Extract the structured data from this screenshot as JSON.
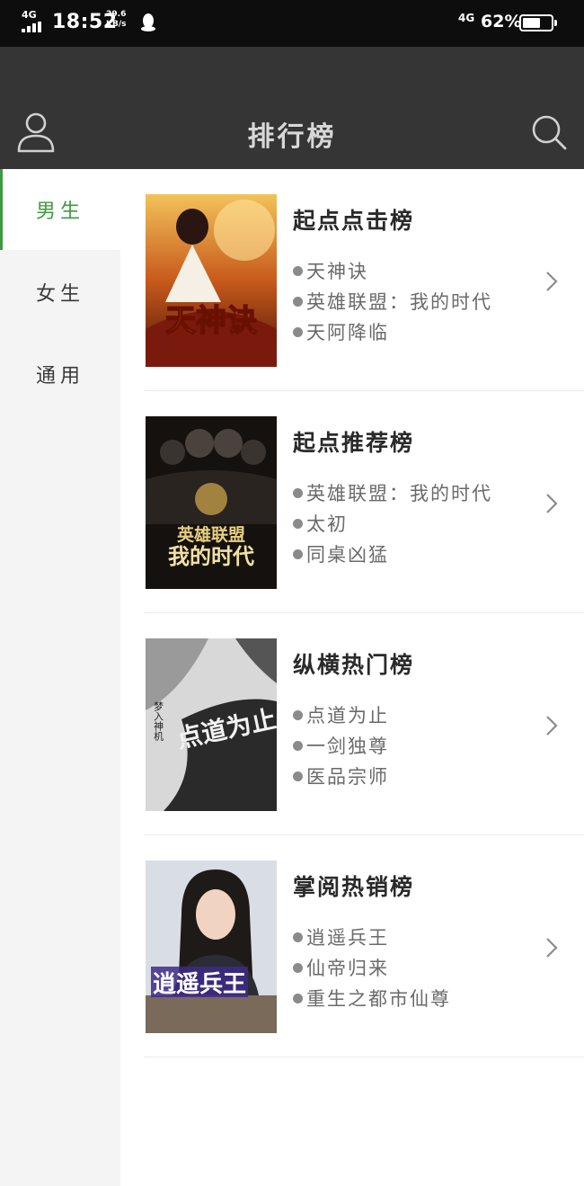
{
  "status_bar": {
    "network_left": "4G",
    "time": "18:52",
    "speed_value": "29.6",
    "speed_unit": "KB/s",
    "network_right": "4G",
    "battery": "62%",
    "battery_level": 0.62
  },
  "header": {
    "title": "排行榜"
  },
  "sidebar": {
    "tabs": [
      {
        "label": "男生",
        "active": true
      },
      {
        "label": "女生",
        "active": false
      },
      {
        "label": "通用",
        "active": false
      }
    ]
  },
  "rankings": [
    {
      "title": "起点点击榜",
      "books": [
        "天神诀",
        "英雄联盟：我的时代",
        "天阿降临"
      ]
    },
    {
      "title": "起点推荐榜",
      "books": [
        "英雄联盟：我的时代",
        "太初",
        "同桌凶猛"
      ]
    },
    {
      "title": "纵横热门榜",
      "books": [
        "点道为止",
        "一剑独尊",
        "医品宗师"
      ]
    },
    {
      "title": "掌阅热销榜",
      "books": [
        "逍遥兵王",
        "仙帝归来",
        "重生之都市仙尊"
      ]
    }
  ],
  "covers": {
    "c1": "天神诀",
    "c2_line1": "英雄联盟",
    "c2_line2": "我的时代",
    "c3_author": "梦入神机",
    "c3_main": "点道为止",
    "c4": "逍遥兵王"
  },
  "colors": {
    "accent_green": "#3e9a3e",
    "header_bg": "#353535",
    "status_bg": "#0d0d0d",
    "sidebar_bg": "#f4f4f4"
  },
  "icons": {
    "user": "user-icon",
    "search": "search-icon",
    "chevron": "chevron-right-icon",
    "qq": "qq-penguin-icon"
  }
}
